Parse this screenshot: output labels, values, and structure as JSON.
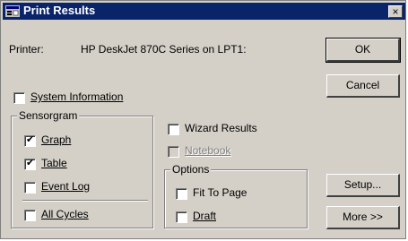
{
  "window": {
    "title": "Print Results",
    "close_label": "×"
  },
  "printer": {
    "label": "Printer:",
    "value": "HP DeskJet 870C Series on LPT1:"
  },
  "system_info": {
    "label": "System Information",
    "checked": false
  },
  "sensorgram": {
    "title": "Sensorgram",
    "graph": {
      "label": "Graph",
      "checked": true
    },
    "table": {
      "label": "Table",
      "checked": true
    },
    "event_log": {
      "label": "Event Log",
      "checked": false
    },
    "all_cycles": {
      "label": "All Cycles",
      "checked": false
    }
  },
  "wizard_results": {
    "label": "Wizard Results",
    "checked": false
  },
  "notebook": {
    "label": "Notebook",
    "checked": false,
    "enabled": false
  },
  "options": {
    "title": "Options",
    "fit_to_page": {
      "label": "Fit To Page",
      "checked": false
    },
    "draft": {
      "label": "Draft",
      "checked": false
    }
  },
  "buttons": {
    "ok": "OK",
    "cancel": "Cancel",
    "setup": "Setup...",
    "more": "More >>"
  }
}
